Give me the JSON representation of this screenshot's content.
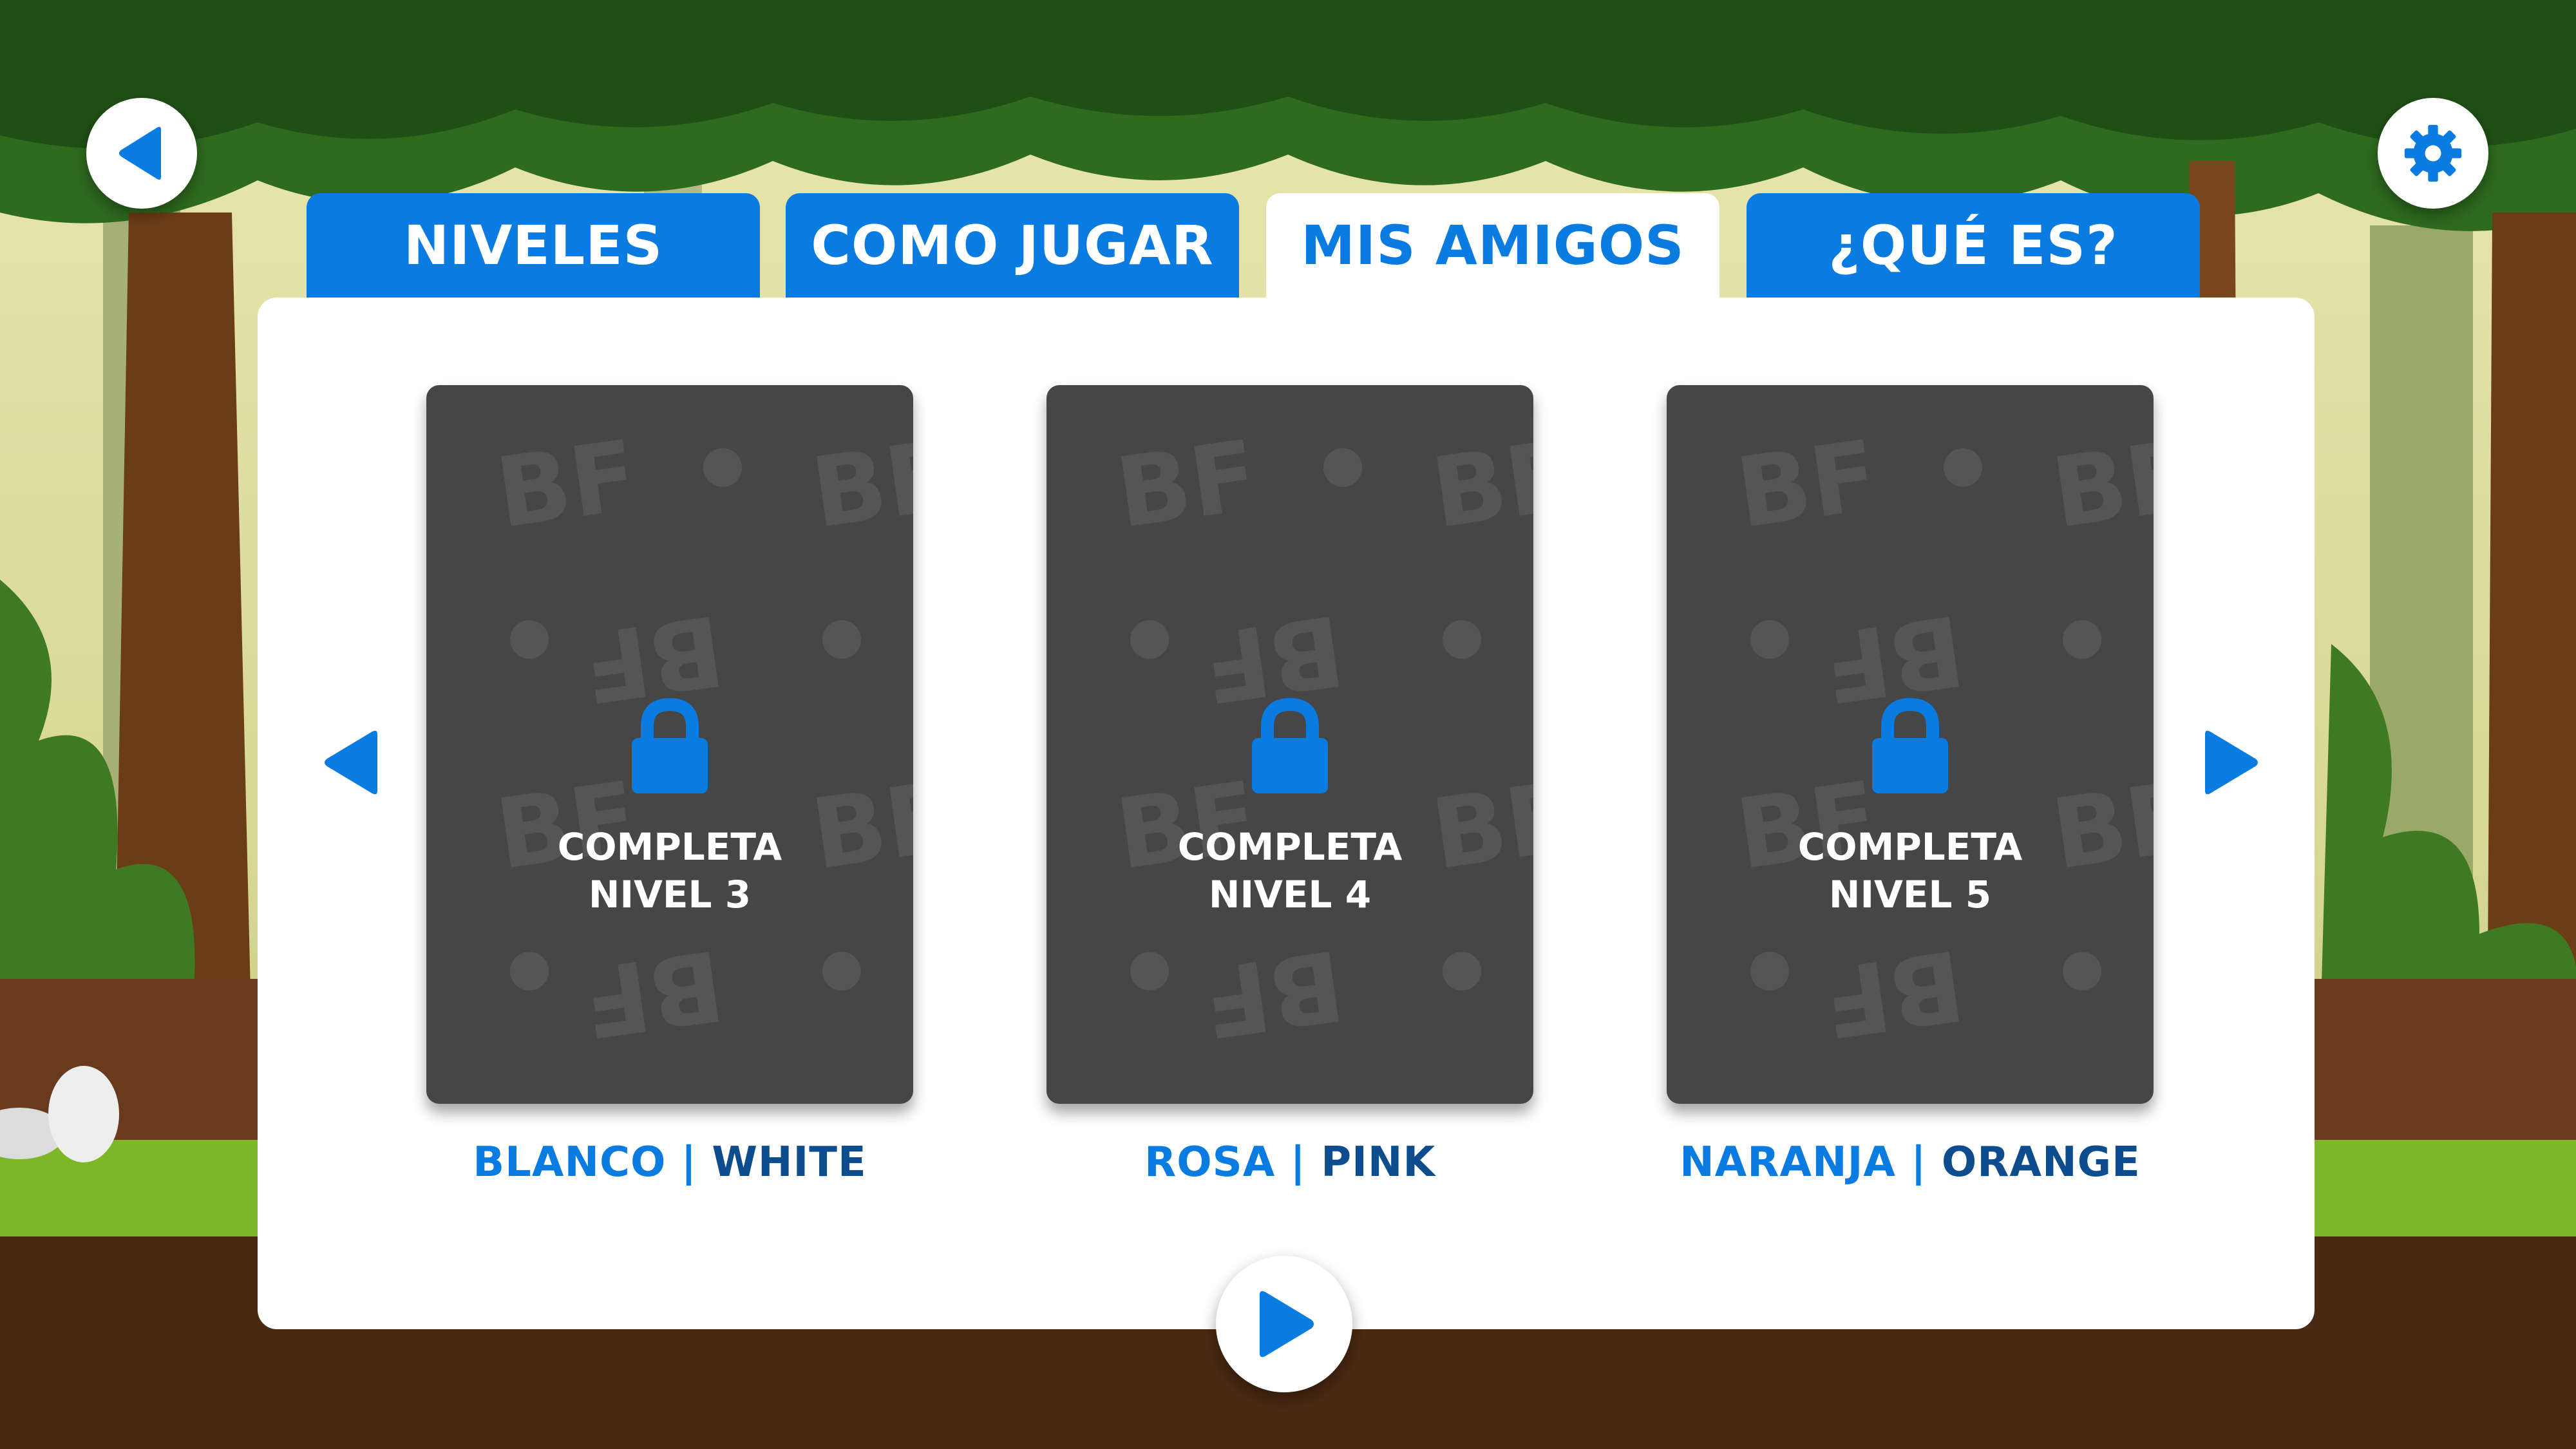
{
  "tabs": [
    {
      "label": "NIVELES",
      "active": false
    },
    {
      "label": "COMO JUGAR",
      "active": false
    },
    {
      "label": "MIS AMIGOS",
      "active": true
    },
    {
      "label": "¿QUÉ ES?",
      "active": false
    }
  ],
  "cards": [
    {
      "line1": "COMPLETA",
      "line2": "NIVEL 3",
      "name_es": "BLANCO",
      "separator": "|",
      "name_en": "WHITE",
      "locked": true
    },
    {
      "line1": "COMPLETA",
      "line2": "NIVEL 4",
      "name_es": "ROSA",
      "separator": "|",
      "name_en": "PINK",
      "locked": true
    },
    {
      "line1": "COMPLETA",
      "line2": "NIVEL 5",
      "name_es": "NARANJA",
      "separator": "|",
      "name_en": "ORANGE",
      "locked": true
    }
  ],
  "card_watermark": "BF",
  "icons": {
    "back": "back-arrow-icon",
    "settings": "gear-icon",
    "prev": "chevron-left-icon",
    "next": "chevron-right-icon",
    "play": "play-icon",
    "lock": "lock-icon"
  },
  "colors": {
    "accent_blue": "#0a7be0",
    "dark_blue": "#0d4d8e",
    "card_bg": "#464646",
    "panel_bg": "#ffffff"
  }
}
